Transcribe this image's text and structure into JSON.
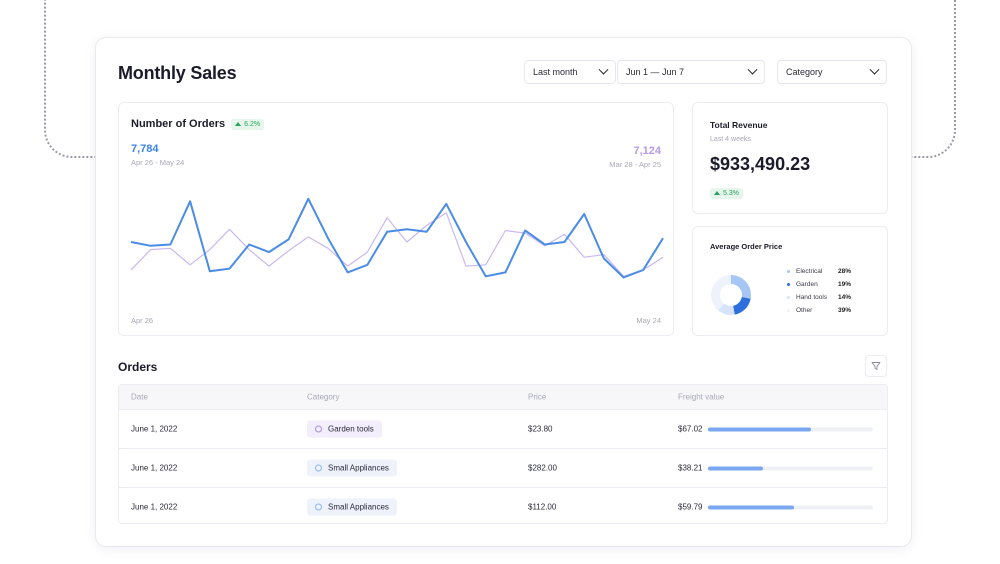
{
  "page": {
    "title": "Monthly Sales"
  },
  "filters": {
    "period": "Last month",
    "date_range": "Jun 1 — Jun 7",
    "category": "Category"
  },
  "orders_chart": {
    "title": "Number of Orders",
    "change": "6.2%",
    "current_value": "7,784",
    "current_range": "Apr 26 - May 24",
    "previous_value": "7,124",
    "previous_range": "Mar 28 - Apr 25",
    "x_start": "Apr 26",
    "x_end": "May 24"
  },
  "chart_data": {
    "type": "line",
    "title": "Number of Orders",
    "x": [
      1,
      2,
      3,
      4,
      5,
      6,
      7,
      8,
      9,
      10,
      11,
      12,
      13,
      14,
      15,
      16,
      17,
      18,
      19,
      20,
      21,
      22,
      23,
      24,
      25,
      26,
      27,
      28,
      29
    ],
    "ylim": [
      0,
      100
    ],
    "series": [
      {
        "name": "Apr 26 - May 24",
        "color": "#4a8ce6",
        "values": [
          52,
          49,
          50,
          84,
          29,
          31,
          50,
          44,
          54,
          86,
          55,
          28,
          34,
          60,
          62,
          60,
          82,
          52,
          25,
          28,
          61,
          50,
          52,
          74,
          39,
          24,
          30,
          55
        ]
      },
      {
        "name": "Mar 28 - Apr 25",
        "color": "#c9b8ef",
        "values": [
          30,
          46,
          47,
          34,
          46,
          62,
          46,
          33,
          45,
          56,
          47,
          33,
          44,
          71,
          52,
          65,
          75,
          33,
          34,
          61,
          59,
          49,
          58,
          40,
          42,
          25,
          30,
          40
        ]
      }
    ]
  },
  "revenue": {
    "title": "Total Revenue",
    "subtitle": "Last 4 weeks",
    "value": "$933,490.23",
    "change": "5.3%"
  },
  "avg_order": {
    "title": "Average Order Price",
    "legend": [
      {
        "label": "Electrical",
        "value": "28%",
        "color": "#a6c6f5"
      },
      {
        "label": "Garden",
        "value": "19%",
        "color": "#2e6fe0"
      },
      {
        "label": "Hand tools",
        "value": "14%",
        "color": "#d6e3f8"
      },
      {
        "label": "Other",
        "value": "39%",
        "color": "#eef2fa"
      }
    ]
  },
  "orders_table": {
    "title": "Orders",
    "columns": [
      "Date",
      "Category",
      "Price",
      "Freight value"
    ],
    "rows": [
      {
        "date": "June 1, 2022",
        "category": "Garden tools",
        "price": "$23.80",
        "freight": "$67.02",
        "freight_fill": 0.62,
        "chip": "purple"
      },
      {
        "date": "June 1, 2022",
        "category": "Small Appliances",
        "price": "$282.00",
        "freight": "$38.21",
        "freight_fill": 0.33,
        "chip": "blue"
      },
      {
        "date": "June 1, 2022",
        "category": "Small Appliances",
        "price": "$112.00",
        "freight": "$59.79",
        "freight_fill": 0.52,
        "chip": "blue"
      }
    ]
  }
}
